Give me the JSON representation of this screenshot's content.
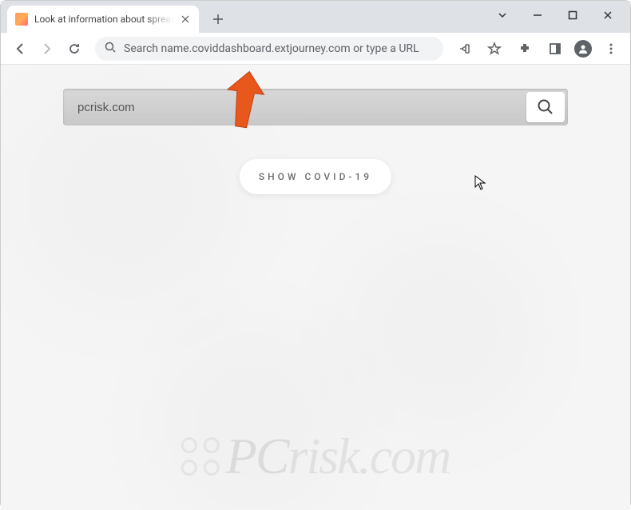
{
  "window": {
    "tab_title": "Look at information about spread",
    "omnibox_placeholder": "Search name.coviddashboard.extjourney.com or type a URL"
  },
  "page": {
    "search_value": "pcrisk.com",
    "show_button_label": "SHOW COVID-19"
  },
  "watermark": {
    "text_prefix": "PC",
    "text_suffix": "risk.com"
  }
}
